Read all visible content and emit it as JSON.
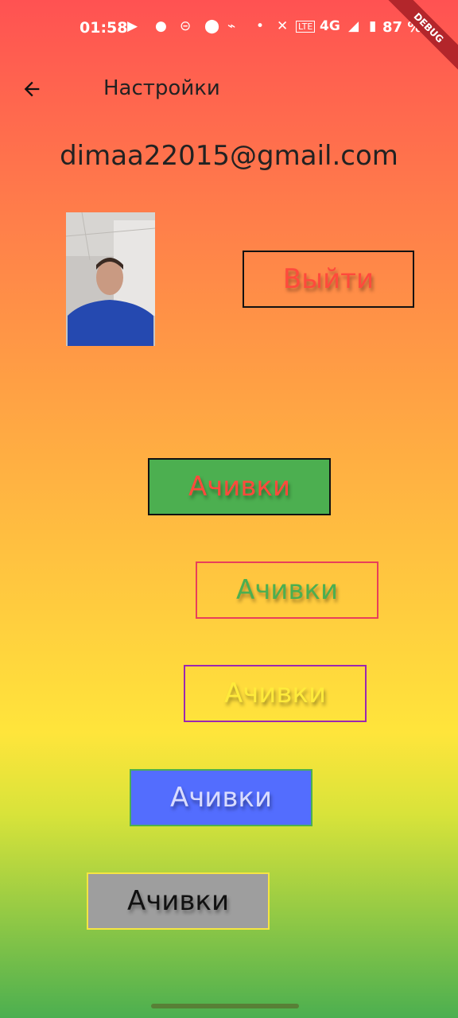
{
  "status_bar": {
    "time": "01:58",
    "network": "4G",
    "battery": "87 %",
    "debug_banner": "DEBUG"
  },
  "app_bar": {
    "title": "Настройки"
  },
  "profile": {
    "email": "dimaa22015@gmail.com",
    "logout_label": "Выйти"
  },
  "buttons": [
    {
      "label": "Ачивки",
      "bg": "#4caf50",
      "border": "#111111",
      "text": "#ff4a3c"
    },
    {
      "label": "Ачивки",
      "bg": "transparent",
      "border": "#e83f5a",
      "text": "#4caf50"
    },
    {
      "label": "Ачивки",
      "bg": "transparent",
      "border": "#9c27b0",
      "text": "#ffeb3b"
    },
    {
      "label": "Ачивки",
      "bg": "#536dfe",
      "border": "#4caf50",
      "text": "#d9dcff"
    },
    {
      "label": "Ачивки",
      "bg": "#9e9e9e",
      "border": "#f5e542",
      "text": "#111111"
    }
  ],
  "icons": [
    "back-arrow-icon",
    "youtube-icon",
    "notification-icon",
    "location-icon",
    "mute-icon",
    "volte-icon",
    "signal-icon",
    "battery-icon"
  ]
}
